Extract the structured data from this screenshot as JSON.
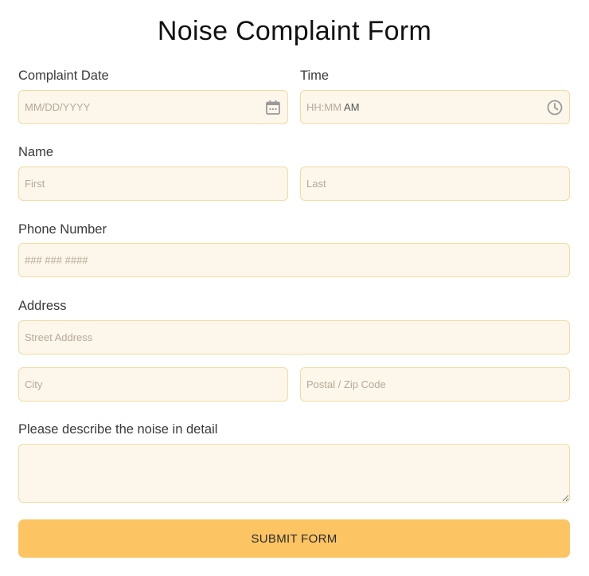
{
  "form": {
    "title": "Noise Complaint Form",
    "submit_label": "SUBMIT FORM"
  },
  "complaint_date": {
    "label": "Complaint Date",
    "placeholder": "MM/DD/YYYY",
    "icon": "calendar-icon"
  },
  "time": {
    "label": "Time",
    "placeholder": "HH:MM",
    "period": "AM",
    "icon": "clock-icon"
  },
  "name": {
    "label": "Name",
    "first_placeholder": "First",
    "last_placeholder": "Last"
  },
  "phone": {
    "label": "Phone Number",
    "placeholder": "### ### ####"
  },
  "address": {
    "label": "Address",
    "street_placeholder": "Street Address",
    "city_placeholder": "City",
    "postal_placeholder": "Postal / Zip Code"
  },
  "description": {
    "label": "Please describe the noise in detail"
  },
  "colors": {
    "field_background": "#fdf6ea",
    "field_border": "#f0dca2",
    "submit_background": "#fcc463"
  }
}
